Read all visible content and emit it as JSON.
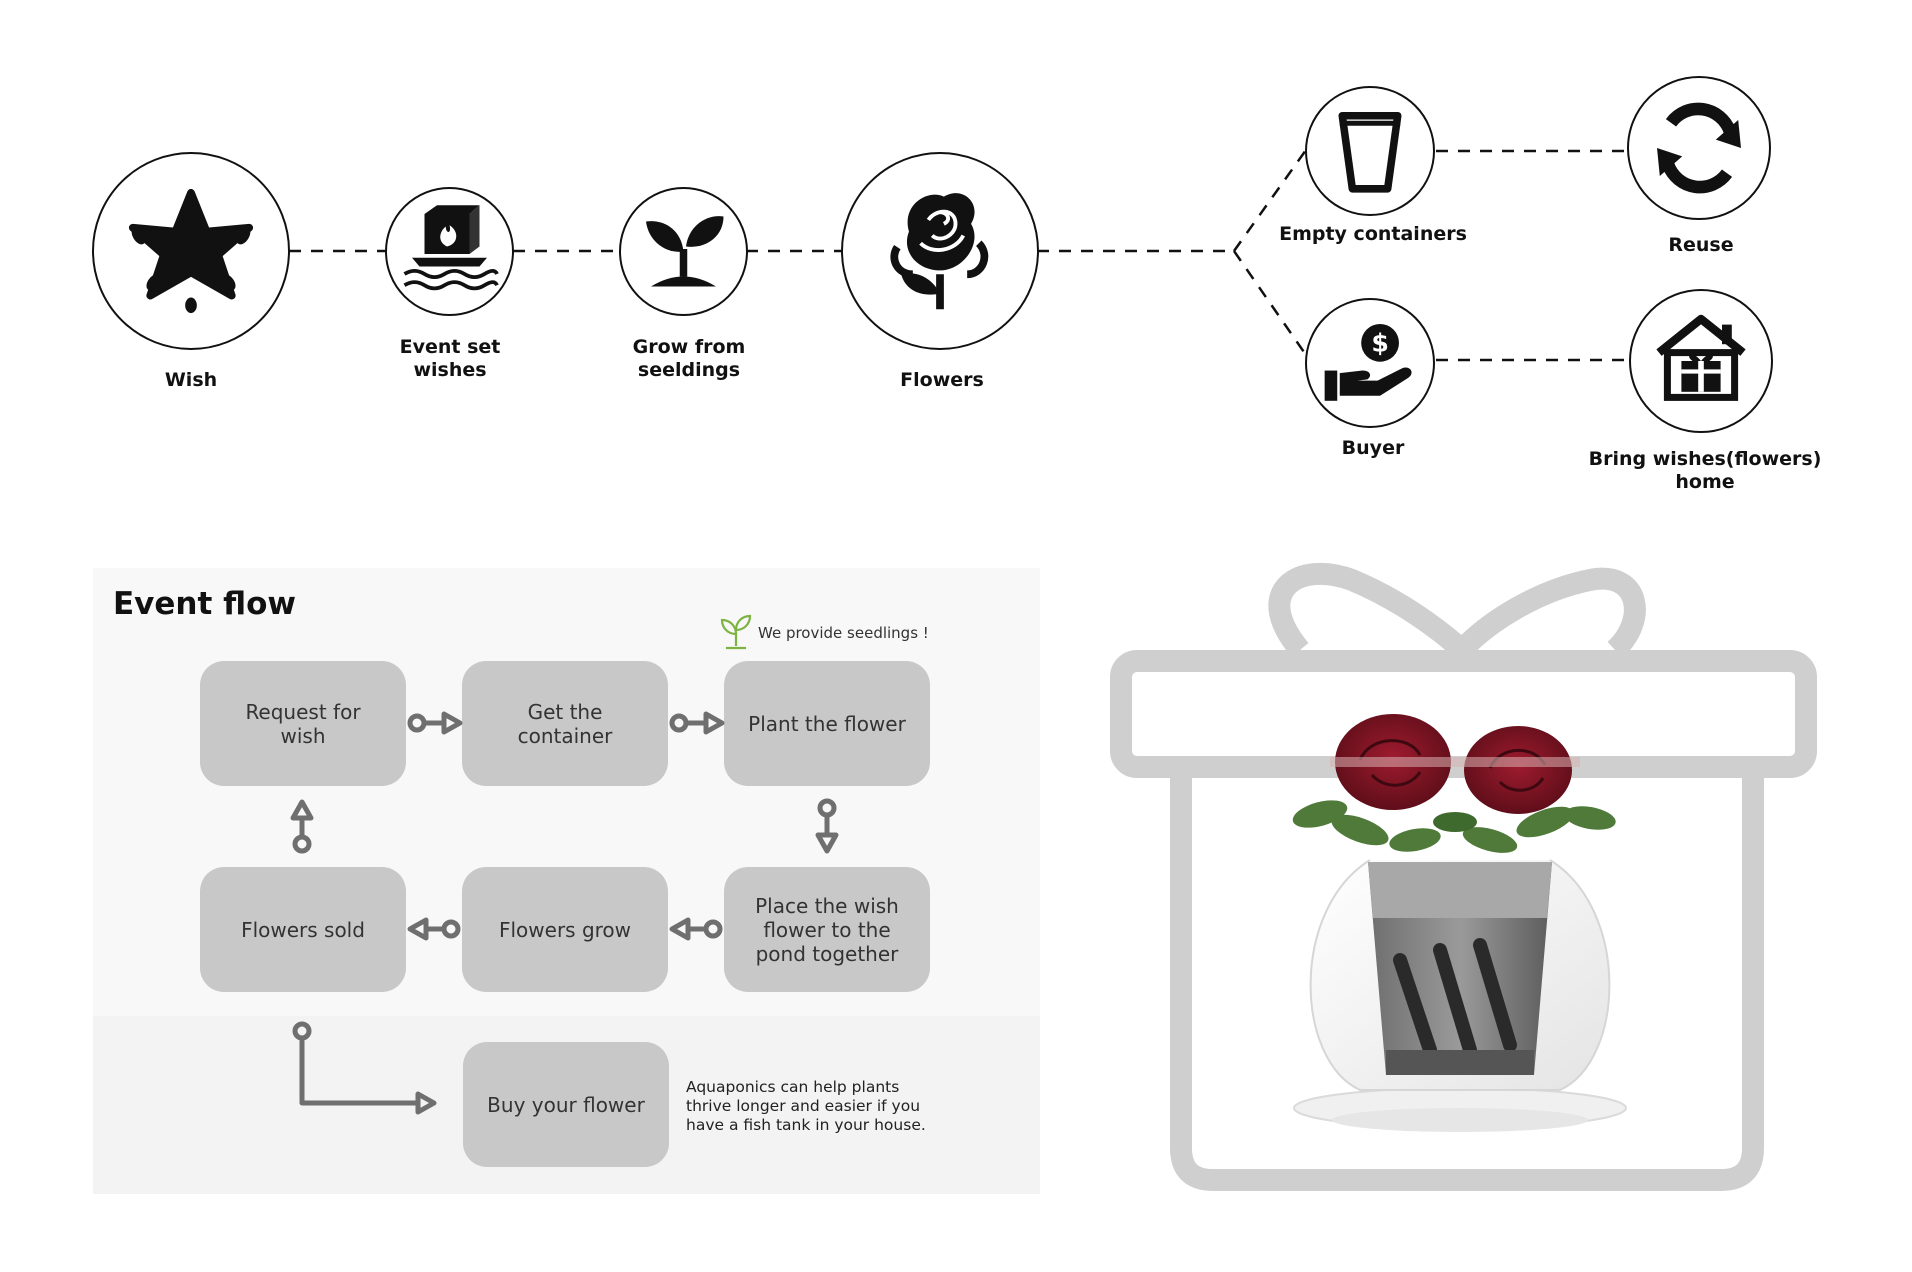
{
  "top_flow": {
    "nodes": [
      {
        "id": "wish",
        "label_lines": [
          "Wish"
        ],
        "icon": "star-icon"
      },
      {
        "id": "event",
        "label_lines": [
          "Event set",
          "wishes"
        ],
        "icon": "burning-box-on-water-icon"
      },
      {
        "id": "grow",
        "label_lines": [
          "Grow from",
          "seeldings"
        ],
        "icon": "seedling-icon"
      },
      {
        "id": "flowers",
        "label_lines": [
          "Flowers"
        ],
        "icon": "rose-icon"
      },
      {
        "id": "empty",
        "label_lines": [
          "Empty containers"
        ],
        "icon": "cup-icon"
      },
      {
        "id": "reuse",
        "label_lines": [
          "Reuse"
        ],
        "icon": "recycle-arrows-icon"
      },
      {
        "id": "buyer",
        "label_lines": [
          "Buyer"
        ],
        "icon": "hand-coin-icon"
      },
      {
        "id": "home",
        "label_lines": [
          "Bring wishes(flowers)",
          "home"
        ],
        "icon": "house-gift-icon"
      }
    ]
  },
  "event_flow": {
    "title": "Event flow",
    "seed_note": "We provide seedlings !",
    "steps": [
      {
        "id": "request",
        "lines": [
          "Request for",
          "wish"
        ]
      },
      {
        "id": "container",
        "lines": [
          "Get the",
          "container"
        ]
      },
      {
        "id": "plant",
        "lines": [
          "Plant the flower"
        ]
      },
      {
        "id": "place",
        "lines": [
          "Place the wish",
          "flower to the",
          "pond together"
        ]
      },
      {
        "id": "grow",
        "lines": [
          "Flowers grow"
        ]
      },
      {
        "id": "sold",
        "lines": [
          "Flowers sold"
        ]
      },
      {
        "id": "buy",
        "lines": [
          "Buy your flower"
        ]
      }
    ],
    "aquaponics_note": [
      "Aquaponics can help plants",
      "thrive longer and easier if you",
      "have a fish tank in your house."
    ]
  },
  "colors": {
    "ink": "#111111",
    "box": "#c8c8c8",
    "arrow": "#6f6f6f",
    "gift_outline": "#cfcfcf",
    "rose": "#7a1422",
    "leaf": "#4f7a3a",
    "seed_green": "#7cb342"
  }
}
